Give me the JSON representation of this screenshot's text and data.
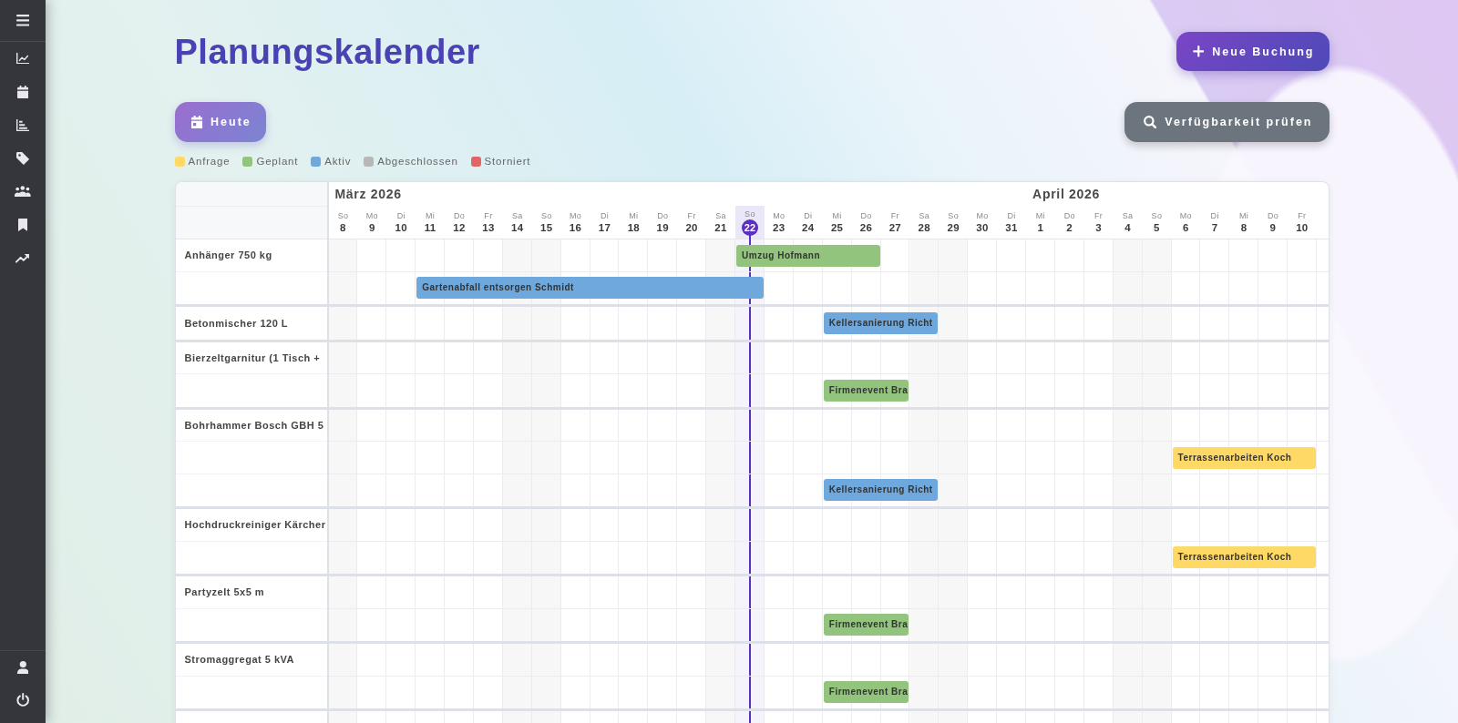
{
  "header": {
    "title": "Planungskalender",
    "new_button": "Neue Buchung"
  },
  "toolbar": {
    "today_button": "Heute",
    "availability_button": "Verfügbarkeit prüfen"
  },
  "legend": [
    {
      "label": "Anfrage",
      "color": "#ffd966"
    },
    {
      "label": "Geplant",
      "color": "#93c47d"
    },
    {
      "label": "Aktiv",
      "color": "#6fa8dc"
    },
    {
      "label": "Abgeschlossen",
      "color": "#b7b7b7"
    },
    {
      "label": "Storniert",
      "color": "#e06666"
    }
  ],
  "calendar": {
    "months": [
      {
        "label": "März 2026",
        "days": [
          {
            "weekday": "So",
            "day": "8",
            "weekend": true,
            "today": false
          },
          {
            "weekday": "Mo",
            "day": "9",
            "weekend": false,
            "today": false
          },
          {
            "weekday": "Di",
            "day": "10",
            "weekend": false,
            "today": false
          },
          {
            "weekday": "Mi",
            "day": "11",
            "weekend": false,
            "today": false
          },
          {
            "weekday": "Do",
            "day": "12",
            "weekend": false,
            "today": false
          },
          {
            "weekday": "Fr",
            "day": "13",
            "weekend": false,
            "today": false
          },
          {
            "weekday": "Sa",
            "day": "14",
            "weekend": true,
            "today": false
          },
          {
            "weekday": "So",
            "day": "15",
            "weekend": true,
            "today": false
          },
          {
            "weekday": "Mo",
            "day": "16",
            "weekend": false,
            "today": false
          },
          {
            "weekday": "Di",
            "day": "17",
            "weekend": false,
            "today": false
          },
          {
            "weekday": "Mi",
            "day": "18",
            "weekend": false,
            "today": false
          },
          {
            "weekday": "Do",
            "day": "19",
            "weekend": false,
            "today": false
          },
          {
            "weekday": "Fr",
            "day": "20",
            "weekend": false,
            "today": false
          },
          {
            "weekday": "Sa",
            "day": "21",
            "weekend": true,
            "today": false
          },
          {
            "weekday": "So",
            "day": "22",
            "weekend": true,
            "today": true
          },
          {
            "weekday": "Mo",
            "day": "23",
            "weekend": false,
            "today": false
          },
          {
            "weekday": "Di",
            "day": "24",
            "weekend": false,
            "today": false
          },
          {
            "weekday": "Mi",
            "day": "25",
            "weekend": false,
            "today": false
          },
          {
            "weekday": "Do",
            "day": "26",
            "weekend": false,
            "today": false
          },
          {
            "weekday": "Fr",
            "day": "27",
            "weekend": false,
            "today": false
          },
          {
            "weekday": "Sa",
            "day": "28",
            "weekend": true,
            "today": false
          },
          {
            "weekday": "So",
            "day": "29",
            "weekend": true,
            "today": false
          },
          {
            "weekday": "Mo",
            "day": "30",
            "weekend": false,
            "today": false
          },
          {
            "weekday": "Di",
            "day": "31",
            "weekend": false,
            "today": false
          }
        ]
      },
      {
        "label": "April 2026",
        "days": [
          {
            "weekday": "Mi",
            "day": "1",
            "weekend": false,
            "today": false
          },
          {
            "weekday": "Do",
            "day": "2",
            "weekend": false,
            "today": false
          },
          {
            "weekday": "Fr",
            "day": "3",
            "weekend": false,
            "today": false
          },
          {
            "weekday": "Sa",
            "day": "4",
            "weekend": true,
            "today": false
          },
          {
            "weekday": "So",
            "day": "5",
            "weekend": true,
            "today": false
          },
          {
            "weekday": "Mo",
            "day": "6",
            "weekend": false,
            "today": false
          },
          {
            "weekday": "Di",
            "day": "7",
            "weekend": false,
            "today": false
          },
          {
            "weekday": "Mi",
            "day": "8",
            "weekend": false,
            "today": false
          },
          {
            "weekday": "Do",
            "day": "9",
            "weekend": false,
            "today": false
          },
          {
            "weekday": "Fr",
            "day": "10",
            "weekend": false,
            "today": false
          }
        ]
      }
    ],
    "resources": [
      {
        "lanes": [
          {
            "label": "Anhänger 750 kg",
            "cells": [
              {
                "kind": "empty"
              },
              {
                "kind": "empty"
              },
              {
                "kind": "empty"
              },
              {
                "kind": "empty"
              },
              {
                "kind": "empty"
              },
              {
                "kind": "empty"
              },
              {
                "kind": "empty"
              },
              {
                "kind": "empty"
              },
              {
                "kind": "empty"
              },
              {
                "kind": "empty"
              },
              {
                "kind": "empty"
              },
              {
                "kind": "empty"
              },
              {
                "kind": "empty"
              },
              {
                "kind": "empty"
              },
              {
                "kind": "booking",
                "label": "Umzug Hofmann",
                "color": "#93c47d"
              },
              {
                "kind": "continued"
              },
              {
                "kind": "continued"
              },
              {
                "kind": "continued"
              },
              {
                "kind": "continued"
              },
              {
                "kind": "empty"
              },
              {
                "kind": "empty"
              },
              {
                "kind": "empty"
              },
              {
                "kind": "empty"
              },
              {
                "kind": "empty"
              },
              {
                "kind": "empty"
              },
              {
                "kind": "empty"
              },
              {
                "kind": "empty"
              },
              {
                "kind": "empty"
              },
              {
                "kind": "empty"
              },
              {
                "kind": "empty"
              },
              {
                "kind": "empty"
              },
              {
                "kind": "empty"
              },
              {
                "kind": "empty"
              },
              {
                "kind": "empty"
              }
            ]
          },
          {
            "cells": [
              {
                "kind": "empty"
              },
              {
                "kind": "empty"
              },
              {
                "kind": "empty"
              },
              {
                "kind": "booking",
                "label": "Gartenabfall entsorgen Schmidt",
                "color": "#6fa8dc"
              },
              {
                "kind": "continued"
              },
              {
                "kind": "continued"
              },
              {
                "kind": "continued"
              },
              {
                "kind": "continued"
              },
              {
                "kind": "continued"
              },
              {
                "kind": "continued"
              },
              {
                "kind": "continued"
              },
              {
                "kind": "continued"
              },
              {
                "kind": "continued"
              },
              {
                "kind": "continued"
              },
              {
                "kind": "continued"
              },
              {
                "kind": "empty"
              },
              {
                "kind": "empty"
              },
              {
                "kind": "empty"
              },
              {
                "kind": "empty"
              },
              {
                "kind": "empty"
              },
              {
                "kind": "empty"
              },
              {
                "kind": "empty"
              },
              {
                "kind": "empty"
              },
              {
                "kind": "empty"
              },
              {
                "kind": "empty"
              },
              {
                "kind": "empty"
              },
              {
                "kind": "empty"
              },
              {
                "kind": "empty"
              },
              {
                "kind": "empty"
              },
              {
                "kind": "empty"
              },
              {
                "kind": "empty"
              },
              {
                "kind": "empty"
              },
              {
                "kind": "empty"
              },
              {
                "kind": "empty"
              }
            ]
          }
        ]
      },
      {
        "lanes": [
          {
            "label": "Betonmischer 120 L",
            "cells": [
              {
                "kind": "empty"
              },
              {
                "kind": "empty"
              },
              {
                "kind": "empty"
              },
              {
                "kind": "empty"
              },
              {
                "kind": "empty"
              },
              {
                "kind": "empty"
              },
              {
                "kind": "empty"
              },
              {
                "kind": "empty"
              },
              {
                "kind": "empty"
              },
              {
                "kind": "empty"
              },
              {
                "kind": "empty"
              },
              {
                "kind": "empty"
              },
              {
                "kind": "empty"
              },
              {
                "kind": "empty"
              },
              {
                "kind": "empty"
              },
              {
                "kind": "empty"
              },
              {
                "kind": "empty"
              },
              {
                "kind": "booking",
                "label": "Kellersanierung Richt",
                "color": "#6fa8dc"
              },
              {
                "kind": "continued"
              },
              {
                "kind": "continued"
              },
              {
                "kind": "continued"
              },
              {
                "kind": "empty"
              },
              {
                "kind": "empty"
              },
              {
                "kind": "empty"
              },
              {
                "kind": "empty"
              },
              {
                "kind": "empty"
              },
              {
                "kind": "empty"
              },
              {
                "kind": "empty"
              },
              {
                "kind": "empty"
              },
              {
                "kind": "empty"
              },
              {
                "kind": "empty"
              },
              {
                "kind": "empty"
              },
              {
                "kind": "empty"
              },
              {
                "kind": "empty"
              }
            ]
          }
        ]
      },
      {
        "lanes": [
          {
            "label": "Bierzeltgarnitur (1 Tisch +",
            "cells": [
              {
                "kind": "empty"
              },
              {
                "kind": "empty"
              },
              {
                "kind": "empty"
              },
              {
                "kind": "empty"
              },
              {
                "kind": "empty"
              },
              {
                "kind": "empty"
              },
              {
                "kind": "empty"
              },
              {
                "kind": "empty"
              },
              {
                "kind": "empty"
              },
              {
                "kind": "empty"
              },
              {
                "kind": "empty"
              },
              {
                "kind": "empty"
              },
              {
                "kind": "empty"
              },
              {
                "kind": "empty"
              },
              {
                "kind": "empty"
              },
              {
                "kind": "empty"
              },
              {
                "kind": "empty"
              },
              {
                "kind": "empty"
              },
              {
                "kind": "empty"
              },
              {
                "kind": "empty"
              },
              {
                "kind": "empty"
              },
              {
                "kind": "empty"
              },
              {
                "kind": "empty"
              },
              {
                "kind": "empty"
              },
              {
                "kind": "empty"
              },
              {
                "kind": "empty"
              },
              {
                "kind": "empty"
              },
              {
                "kind": "empty"
              },
              {
                "kind": "empty"
              },
              {
                "kind": "empty"
              },
              {
                "kind": "empty"
              },
              {
                "kind": "empty"
              },
              {
                "kind": "empty"
              },
              {
                "kind": "empty"
              }
            ]
          },
          {
            "cells": [
              {
                "kind": "empty"
              },
              {
                "kind": "empty"
              },
              {
                "kind": "empty"
              },
              {
                "kind": "empty"
              },
              {
                "kind": "empty"
              },
              {
                "kind": "empty"
              },
              {
                "kind": "empty"
              },
              {
                "kind": "empty"
              },
              {
                "kind": "empty"
              },
              {
                "kind": "empty"
              },
              {
                "kind": "empty"
              },
              {
                "kind": "empty"
              },
              {
                "kind": "empty"
              },
              {
                "kind": "empty"
              },
              {
                "kind": "empty"
              },
              {
                "kind": "empty"
              },
              {
                "kind": "empty"
              },
              {
                "kind": "booking",
                "label": "Firmenevent Bra",
                "color": "#93c47d"
              },
              {
                "kind": "continued"
              },
              {
                "kind": "continued"
              },
              {
                "kind": "empty"
              },
              {
                "kind": "empty"
              },
              {
                "kind": "empty"
              },
              {
                "kind": "empty"
              },
              {
                "kind": "empty"
              },
              {
                "kind": "empty"
              },
              {
                "kind": "empty"
              },
              {
                "kind": "empty"
              },
              {
                "kind": "empty"
              },
              {
                "kind": "empty"
              },
              {
                "kind": "empty"
              },
              {
                "kind": "empty"
              },
              {
                "kind": "empty"
              },
              {
                "kind": "empty"
              }
            ]
          }
        ]
      },
      {
        "lanes": [
          {
            "label": "Bohrhammer Bosch GBH 5",
            "cells": [
              {
                "kind": "empty"
              },
              {
                "kind": "empty"
              },
              {
                "kind": "empty"
              },
              {
                "kind": "empty"
              },
              {
                "kind": "empty"
              },
              {
                "kind": "empty"
              },
              {
                "kind": "empty"
              },
              {
                "kind": "empty"
              },
              {
                "kind": "empty"
              },
              {
                "kind": "empty"
              },
              {
                "kind": "empty"
              },
              {
                "kind": "empty"
              },
              {
                "kind": "empty"
              },
              {
                "kind": "empty"
              },
              {
                "kind": "empty"
              },
              {
                "kind": "empty"
              },
              {
                "kind": "empty"
              },
              {
                "kind": "empty"
              },
              {
                "kind": "empty"
              },
              {
                "kind": "empty"
              },
              {
                "kind": "empty"
              },
              {
                "kind": "empty"
              },
              {
                "kind": "empty"
              },
              {
                "kind": "empty"
              },
              {
                "kind": "empty"
              },
              {
                "kind": "empty"
              },
              {
                "kind": "empty"
              },
              {
                "kind": "empty"
              },
              {
                "kind": "empty"
              },
              {
                "kind": "empty"
              },
              {
                "kind": "empty"
              },
              {
                "kind": "empty"
              },
              {
                "kind": "empty"
              },
              {
                "kind": "empty"
              }
            ]
          },
          {
            "cells": [
              {
                "kind": "empty"
              },
              {
                "kind": "empty"
              },
              {
                "kind": "empty"
              },
              {
                "kind": "empty"
              },
              {
                "kind": "empty"
              },
              {
                "kind": "empty"
              },
              {
                "kind": "empty"
              },
              {
                "kind": "empty"
              },
              {
                "kind": "empty"
              },
              {
                "kind": "empty"
              },
              {
                "kind": "empty"
              },
              {
                "kind": "empty"
              },
              {
                "kind": "empty"
              },
              {
                "kind": "empty"
              },
              {
                "kind": "empty"
              },
              {
                "kind": "empty"
              },
              {
                "kind": "empty"
              },
              {
                "kind": "empty"
              },
              {
                "kind": "empty"
              },
              {
                "kind": "empty"
              },
              {
                "kind": "empty"
              },
              {
                "kind": "empty"
              },
              {
                "kind": "empty"
              },
              {
                "kind": "empty"
              },
              {
                "kind": "empty"
              },
              {
                "kind": "empty"
              },
              {
                "kind": "empty"
              },
              {
                "kind": "empty"
              },
              {
                "kind": "empty"
              },
              {
                "kind": "booking",
                "label": "Terrassenarbeiten Koch",
                "color": "#ffd966"
              },
              {
                "kind": "continued"
              },
              {
                "kind": "continued"
              },
              {
                "kind": "continued"
              },
              {
                "kind": "continued"
              }
            ]
          },
          {
            "cells": [
              {
                "kind": "empty"
              },
              {
                "kind": "empty"
              },
              {
                "kind": "empty"
              },
              {
                "kind": "empty"
              },
              {
                "kind": "empty"
              },
              {
                "kind": "empty"
              },
              {
                "kind": "empty"
              },
              {
                "kind": "empty"
              },
              {
                "kind": "empty"
              },
              {
                "kind": "empty"
              },
              {
                "kind": "empty"
              },
              {
                "kind": "empty"
              },
              {
                "kind": "empty"
              },
              {
                "kind": "empty"
              },
              {
                "kind": "empty"
              },
              {
                "kind": "empty"
              },
              {
                "kind": "empty"
              },
              {
                "kind": "booking",
                "label": "Kellersanierung Richt",
                "color": "#6fa8dc"
              },
              {
                "kind": "continued"
              },
              {
                "kind": "continued"
              },
              {
                "kind": "continued"
              },
              {
                "kind": "empty"
              },
              {
                "kind": "empty"
              },
              {
                "kind": "empty"
              },
              {
                "kind": "empty"
              },
              {
                "kind": "empty"
              },
              {
                "kind": "empty"
              },
              {
                "kind": "empty"
              },
              {
                "kind": "empty"
              },
              {
                "kind": "empty"
              },
              {
                "kind": "empty"
              },
              {
                "kind": "empty"
              },
              {
                "kind": "empty"
              },
              {
                "kind": "empty"
              }
            ]
          }
        ]
      },
      {
        "lanes": [
          {
            "label": "Hochdruckreiniger Kärcher",
            "cells": [
              {
                "kind": "empty"
              },
              {
                "kind": "empty"
              },
              {
                "kind": "empty"
              },
              {
                "kind": "empty"
              },
              {
                "kind": "empty"
              },
              {
                "kind": "empty"
              },
              {
                "kind": "empty"
              },
              {
                "kind": "empty"
              },
              {
                "kind": "empty"
              },
              {
                "kind": "empty"
              },
              {
                "kind": "empty"
              },
              {
                "kind": "empty"
              },
              {
                "kind": "empty"
              },
              {
                "kind": "empty"
              },
              {
                "kind": "empty"
              },
              {
                "kind": "empty"
              },
              {
                "kind": "empty"
              },
              {
                "kind": "empty"
              },
              {
                "kind": "empty"
              },
              {
                "kind": "empty"
              },
              {
                "kind": "empty"
              },
              {
                "kind": "empty"
              },
              {
                "kind": "empty"
              },
              {
                "kind": "empty"
              },
              {
                "kind": "empty"
              },
              {
                "kind": "empty"
              },
              {
                "kind": "empty"
              },
              {
                "kind": "empty"
              },
              {
                "kind": "empty"
              },
              {
                "kind": "empty"
              },
              {
                "kind": "empty"
              },
              {
                "kind": "empty"
              },
              {
                "kind": "empty"
              },
              {
                "kind": "empty"
              }
            ]
          },
          {
            "cells": [
              {
                "kind": "empty"
              },
              {
                "kind": "empty"
              },
              {
                "kind": "empty"
              },
              {
                "kind": "empty"
              },
              {
                "kind": "empty"
              },
              {
                "kind": "empty"
              },
              {
                "kind": "empty"
              },
              {
                "kind": "empty"
              },
              {
                "kind": "empty"
              },
              {
                "kind": "empty"
              },
              {
                "kind": "empty"
              },
              {
                "kind": "empty"
              },
              {
                "kind": "empty"
              },
              {
                "kind": "empty"
              },
              {
                "kind": "empty"
              },
              {
                "kind": "empty"
              },
              {
                "kind": "empty"
              },
              {
                "kind": "empty"
              },
              {
                "kind": "empty"
              },
              {
                "kind": "empty"
              },
              {
                "kind": "empty"
              },
              {
                "kind": "empty"
              },
              {
                "kind": "empty"
              },
              {
                "kind": "empty"
              },
              {
                "kind": "empty"
              },
              {
                "kind": "empty"
              },
              {
                "kind": "empty"
              },
              {
                "kind": "empty"
              },
              {
                "kind": "empty"
              },
              {
                "kind": "booking",
                "label": "Terrassenarbeiten Koch",
                "color": "#ffd966"
              },
              {
                "kind": "continued"
              },
              {
                "kind": "continued"
              },
              {
                "kind": "continued"
              },
              {
                "kind": "continued"
              }
            ]
          }
        ]
      },
      {
        "lanes": [
          {
            "label": "Partyzelt 5x5 m",
            "cells": [
              {
                "kind": "empty"
              },
              {
                "kind": "empty"
              },
              {
                "kind": "empty"
              },
              {
                "kind": "empty"
              },
              {
                "kind": "empty"
              },
              {
                "kind": "empty"
              },
              {
                "kind": "empty"
              },
              {
                "kind": "empty"
              },
              {
                "kind": "empty"
              },
              {
                "kind": "empty"
              },
              {
                "kind": "empty"
              },
              {
                "kind": "empty"
              },
              {
                "kind": "empty"
              },
              {
                "kind": "empty"
              },
              {
                "kind": "empty"
              },
              {
                "kind": "empty"
              },
              {
                "kind": "empty"
              },
              {
                "kind": "empty"
              },
              {
                "kind": "empty"
              },
              {
                "kind": "empty"
              },
              {
                "kind": "empty"
              },
              {
                "kind": "empty"
              },
              {
                "kind": "empty"
              },
              {
                "kind": "empty"
              },
              {
                "kind": "empty"
              },
              {
                "kind": "empty"
              },
              {
                "kind": "empty"
              },
              {
                "kind": "empty"
              },
              {
                "kind": "empty"
              },
              {
                "kind": "empty"
              },
              {
                "kind": "empty"
              },
              {
                "kind": "empty"
              },
              {
                "kind": "empty"
              },
              {
                "kind": "empty"
              }
            ]
          },
          {
            "cells": [
              {
                "kind": "empty"
              },
              {
                "kind": "empty"
              },
              {
                "kind": "empty"
              },
              {
                "kind": "empty"
              },
              {
                "kind": "empty"
              },
              {
                "kind": "empty"
              },
              {
                "kind": "empty"
              },
              {
                "kind": "empty"
              },
              {
                "kind": "empty"
              },
              {
                "kind": "empty"
              },
              {
                "kind": "empty"
              },
              {
                "kind": "empty"
              },
              {
                "kind": "empty"
              },
              {
                "kind": "empty"
              },
              {
                "kind": "empty"
              },
              {
                "kind": "empty"
              },
              {
                "kind": "empty"
              },
              {
                "kind": "booking",
                "label": "Firmenevent Bra",
                "color": "#93c47d"
              },
              {
                "kind": "continued"
              },
              {
                "kind": "continued"
              },
              {
                "kind": "empty"
              },
              {
                "kind": "empty"
              },
              {
                "kind": "empty"
              },
              {
                "kind": "empty"
              },
              {
                "kind": "empty"
              },
              {
                "kind": "empty"
              },
              {
                "kind": "empty"
              },
              {
                "kind": "empty"
              },
              {
                "kind": "empty"
              },
              {
                "kind": "empty"
              },
              {
                "kind": "empty"
              },
              {
                "kind": "empty"
              },
              {
                "kind": "empty"
              },
              {
                "kind": "empty"
              }
            ]
          }
        ]
      },
      {
        "lanes": [
          {
            "label": "Stromaggregat 5 kVA",
            "cells": [
              {
                "kind": "empty"
              },
              {
                "kind": "empty"
              },
              {
                "kind": "empty"
              },
              {
                "kind": "empty"
              },
              {
                "kind": "empty"
              },
              {
                "kind": "empty"
              },
              {
                "kind": "empty"
              },
              {
                "kind": "empty"
              },
              {
                "kind": "empty"
              },
              {
                "kind": "empty"
              },
              {
                "kind": "empty"
              },
              {
                "kind": "empty"
              },
              {
                "kind": "empty"
              },
              {
                "kind": "empty"
              },
              {
                "kind": "empty"
              },
              {
                "kind": "empty"
              },
              {
                "kind": "empty"
              },
              {
                "kind": "empty"
              },
              {
                "kind": "empty"
              },
              {
                "kind": "empty"
              },
              {
                "kind": "empty"
              },
              {
                "kind": "empty"
              },
              {
                "kind": "empty"
              },
              {
                "kind": "empty"
              },
              {
                "kind": "empty"
              },
              {
                "kind": "empty"
              },
              {
                "kind": "empty"
              },
              {
                "kind": "empty"
              },
              {
                "kind": "empty"
              },
              {
                "kind": "empty"
              },
              {
                "kind": "empty"
              },
              {
                "kind": "empty"
              },
              {
                "kind": "empty"
              },
              {
                "kind": "empty"
              }
            ]
          },
          {
            "cells": [
              {
                "kind": "empty"
              },
              {
                "kind": "empty"
              },
              {
                "kind": "empty"
              },
              {
                "kind": "empty"
              },
              {
                "kind": "empty"
              },
              {
                "kind": "empty"
              },
              {
                "kind": "empty"
              },
              {
                "kind": "empty"
              },
              {
                "kind": "empty"
              },
              {
                "kind": "empty"
              },
              {
                "kind": "empty"
              },
              {
                "kind": "empty"
              },
              {
                "kind": "empty"
              },
              {
                "kind": "empty"
              },
              {
                "kind": "empty"
              },
              {
                "kind": "empty"
              },
              {
                "kind": "empty"
              },
              {
                "kind": "booking",
                "label": "Firmenevent Bra",
                "color": "#93c47d"
              },
              {
                "kind": "continued"
              },
              {
                "kind": "continued"
              },
              {
                "kind": "empty"
              },
              {
                "kind": "empty"
              },
              {
                "kind": "empty"
              },
              {
                "kind": "empty"
              },
              {
                "kind": "empty"
              },
              {
                "kind": "empty"
              },
              {
                "kind": "empty"
              },
              {
                "kind": "empty"
              },
              {
                "kind": "empty"
              },
              {
                "kind": "empty"
              },
              {
                "kind": "empty"
              },
              {
                "kind": "empty"
              },
              {
                "kind": "empty"
              },
              {
                "kind": "empty"
              }
            ]
          }
        ]
      }
    ]
  }
}
